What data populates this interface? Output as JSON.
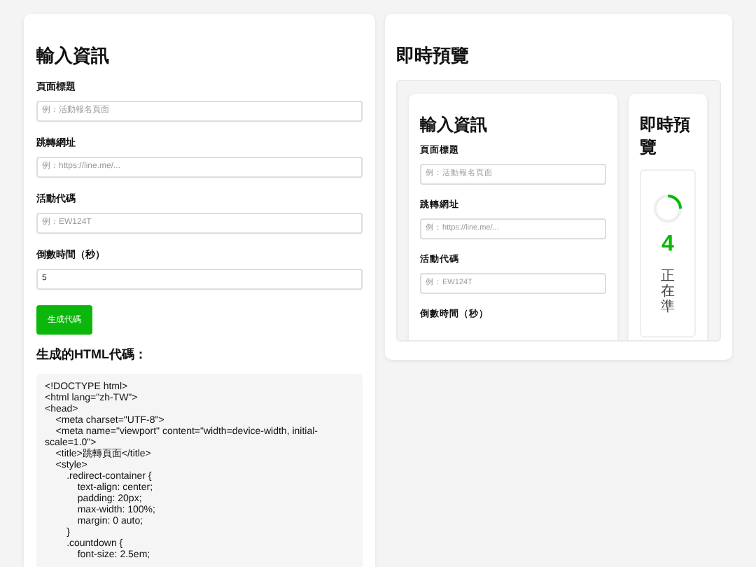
{
  "input_panel": {
    "title": "輸入資訊",
    "fields": [
      {
        "label": "頁面標題",
        "placeholder": "例：活動報名頁面"
      },
      {
        "label": "跳轉網址",
        "placeholder": "例：https://line.me/..."
      },
      {
        "label": "活動代碼",
        "placeholder": "例：EW124T"
      },
      {
        "label": "倒數時間（秒）",
        "value": "5"
      }
    ],
    "button": "生成代碼",
    "output_title": "生成的HTML代碼：",
    "code": "<!DOCTYPE html>\n<html lang=\"zh-TW\">\n<head>\n    <meta charset=\"UTF-8\">\n    <meta name=\"viewport\" content=\"width=device-width, initial-scale=1.0\">\n    <title>跳轉頁面</title>\n    <style>\n        .redirect-container {\n            text-align: center;\n            padding: 20px;\n            max-width: 100%;\n            margin: 0 auto;\n        }\n        .countdown {\n            font-size: 2.5em;"
  },
  "preview_panel": {
    "title": "即時預覽",
    "form": {
      "title": "輸入資訊",
      "fields": [
        {
          "label": "頁面標題",
          "placeholder": "例：活動報名頁面"
        },
        {
          "label": "跳轉網址",
          "placeholder": "例：https://line.me/..."
        },
        {
          "label": "活動代碼",
          "placeholder": "例：EW124T"
        },
        {
          "label": "倒數時間（秒）"
        }
      ]
    },
    "preview": {
      "title": "即時預覽",
      "countdown": "4",
      "message": "正在準"
    }
  }
}
